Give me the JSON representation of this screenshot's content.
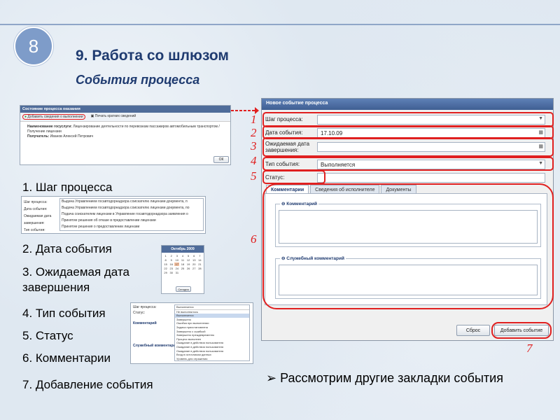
{
  "slide": {
    "number": "8",
    "title": "9. Работа со шлюзом",
    "subtitle": "События процесса"
  },
  "screens": {
    "process_state": {
      "title": "Состояние процесса оказания",
      "add_event": "Добавить сведения о выполнении",
      "print": "Печать кратких сведений",
      "service_label": "Наименование госуслуги:",
      "service_value": "Лицензирование деятельности по перевозкам пассажиров автомобильным транспортом / Получение лицензии",
      "recipient_label": "Получатель:",
      "recipient_value": "Иванов Алексей Петрович",
      "ok": "ОК"
    },
    "step_list": {
      "step_label": "Шаг процесса:",
      "date_label": "Дата события:",
      "expected_label": "Ожидаемая дата завершения:",
      "type_label": "Тип события:",
      "items": [
        "Выдача Управлением госавтодорнадзора соискателю лицензии документа, п",
        "Выдача Управлением госавтодорнадзора соискателю лицензии документа, по",
        "Подача соискателем лицензии в Управление госавтодорнадзора заявления о",
        "Принятие решения об отказе в предоставлении лицензии",
        "Принятие решения о предоставлении лицензии"
      ]
    },
    "calendar": {
      "header": "Октябрь 2009",
      "today": "Сегодня"
    },
    "type_list": {
      "step_label": "Шаг процесса:",
      "status_label": "Статус:",
      "comment": "Комментарий",
      "service_comment": "Служебный комментарий",
      "current": "Выполняется",
      "items": [
        "Не выполнялось",
        "Выполняется",
        "Завершено",
        "Ошибка при выполнении",
        "Задача приостановлена",
        "Завершено с ошибкой",
        "Завершено преждевременно",
        "Процесс выполнен",
        "Ожидание в действия пользователя",
        "Ожидание в действия пользователя",
        "Ожидание в действия пользователя",
        "Вход в источником данных",
        "Уровень для отражения"
      ]
    }
  },
  "labels": {
    "l1": "1. Шаг процесса",
    "l2": "2. Дата события",
    "l3": "3. Ожидаемая дата завершения",
    "l4": "4. Тип события",
    "l5": "5. Статус",
    "l6": "6. Комментарии",
    "l7": "7. Добавление события"
  },
  "dialog": {
    "title": "Новое событие процесса",
    "step_label": "Шаг процесса:",
    "date_label": "Дата события:",
    "date_value": "17.10.09",
    "expected_label": "Ожидаемая дата завершения:",
    "type_label": "Тип события:",
    "type_value": "Выполняется",
    "status_label": "Статус:",
    "tabs": [
      "Комментарии",
      "Сведения об исполнителе",
      "Документы"
    ],
    "comment_header": "Комментарий",
    "service_comment_header": "Служебный комментарий",
    "reset": "Сброс",
    "add": "Добавить событие"
  },
  "markers": [
    "1",
    "2",
    "3",
    "4",
    "5",
    "6",
    "7"
  ],
  "bullet": "Рассмотрим другие закладки события",
  "colors": {
    "accent": "#1f3b70",
    "highlight": "#e02020",
    "badge": "#7e9cc9"
  }
}
